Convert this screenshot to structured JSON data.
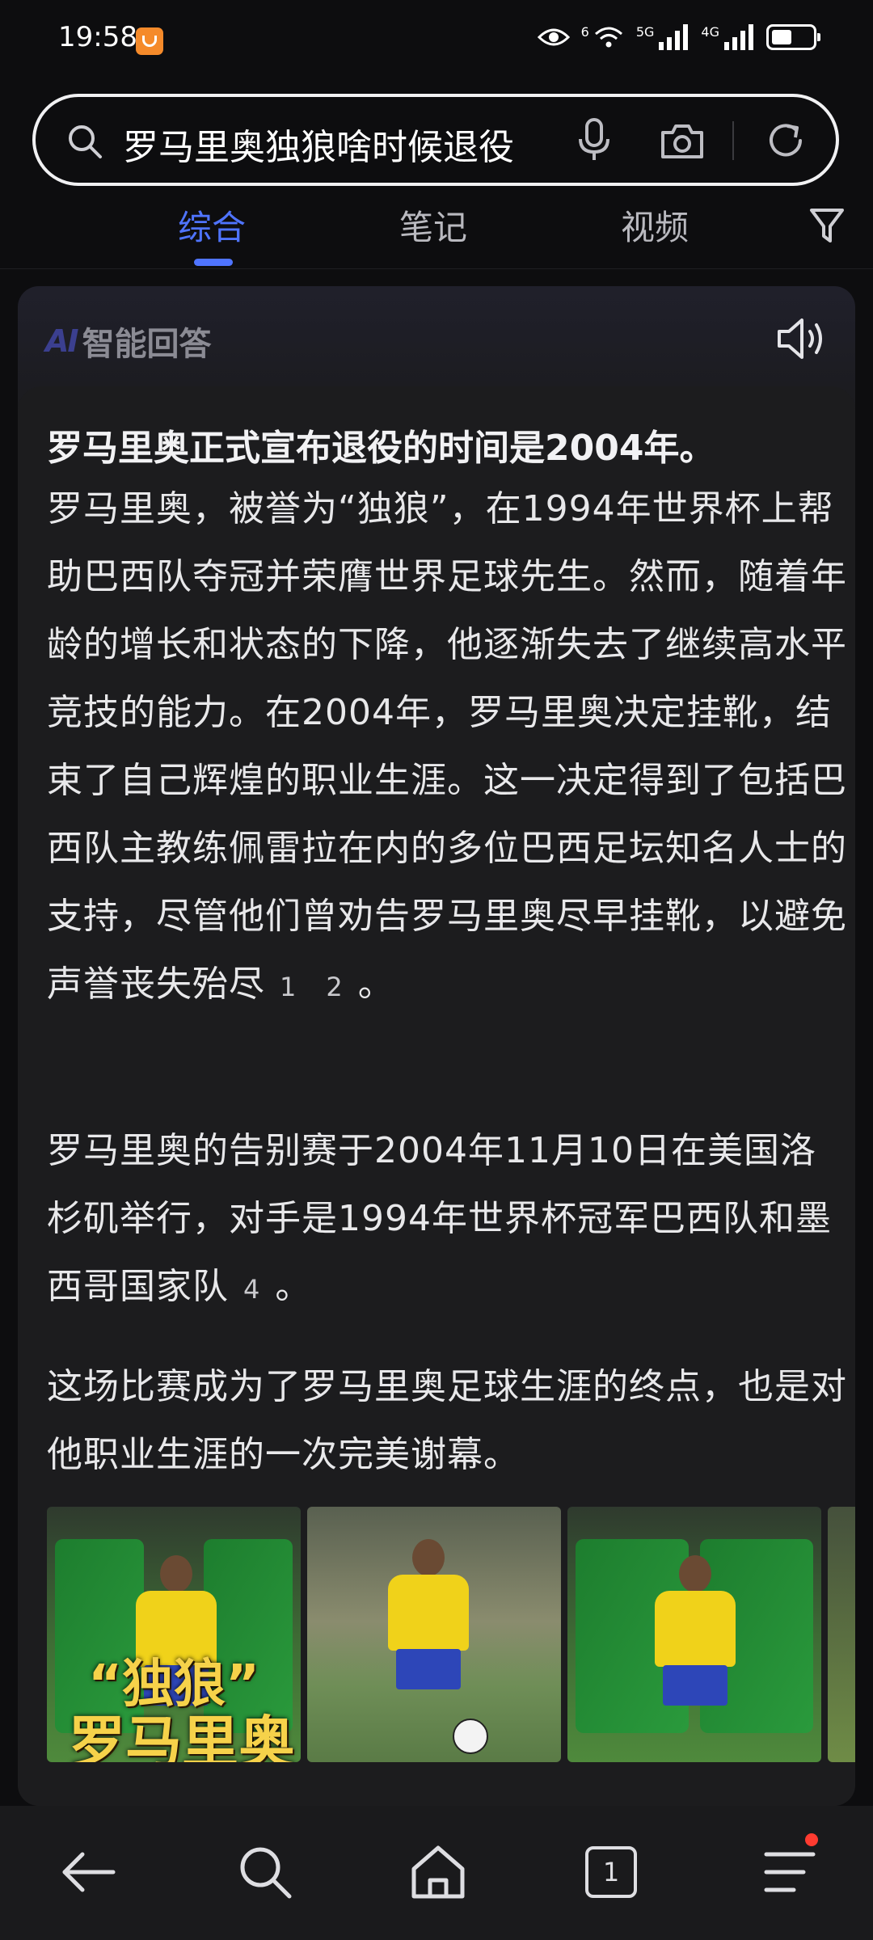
{
  "status_bar": {
    "time": "19:58",
    "net_wifi_label": "6",
    "net_5g_label": "5G",
    "net_4g_label": "4G"
  },
  "search": {
    "query": "罗马里奥独狼啥时候退役",
    "icons": [
      "search-icon",
      "microphone-icon",
      "camera-icon",
      "refresh-icon"
    ]
  },
  "tabs": [
    {
      "label": "综合",
      "active": true
    },
    {
      "label": "笔记",
      "active": false
    },
    {
      "label": "视频",
      "active": false
    }
  ],
  "ai_card": {
    "logo": "AI",
    "title": "智能回答",
    "headline": "罗马里奥正式宣布退役的时间是2004年。",
    "paragraphs": [
      {
        "text": "罗马里奥，被誉为“独狼”，在1994年世界杯上帮助巴西队夺冠并荣膺世界足球先生。然而，随着年龄的增长和状态的下降，他逐渐失去了继续高水平竞技的能力。在2004年，罗马里奥决定挂靴，结束了自己辉煌的职业生涯。这一决定得到了包括巴西队主教练佩雷拉在内的多位巴西足坛知名人士的支持，尽管他们曾劝告罗马里奥尽早挂靴，以避免声誉丧失殆尽",
        "citations": [
          "1",
          "2"
        ],
        "end": "。"
      },
      {
        "text": "罗马里奥的告别赛于2004年11月10日在美国洛杉矶举行，对手是1994年世界杯冠军巴西队和墨西哥国家队",
        "citations": [
          "4"
        ],
        "end": "。"
      },
      {
        "text": "这场比赛成为了罗马里奥足球生涯的终点，也是对他职业生涯的一次完美谢幕。",
        "citations": [],
        "end": ""
      }
    ],
    "image_overlay_line1": "“独狼”",
    "image_overlay_line2": "罗马里奥"
  },
  "bottom_nav": {
    "tab_count": "1",
    "items": [
      "back-icon",
      "search-icon",
      "home-icon",
      "tabs-icon",
      "menu-icon"
    ]
  },
  "colors": {
    "accent": "#4f74ff",
    "background": "#0d0d0f",
    "card": "#1c1c1e",
    "notification": "#ff3b30"
  }
}
